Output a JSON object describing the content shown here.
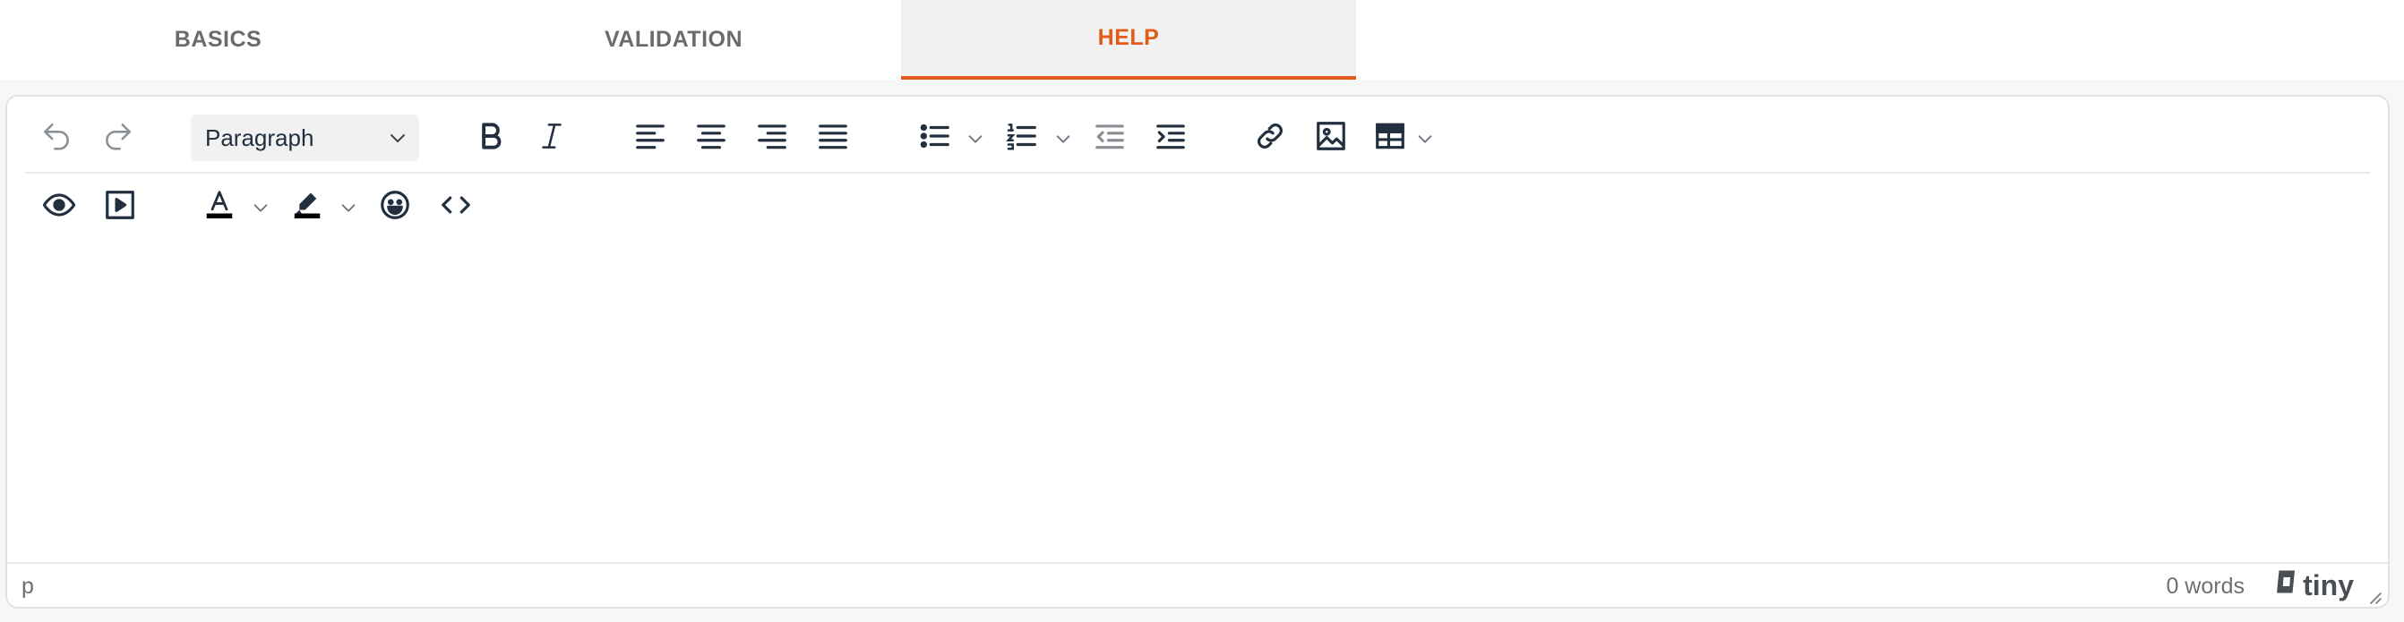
{
  "tabs": [
    {
      "label": "BASICS",
      "active": false
    },
    {
      "label": "VALIDATION",
      "active": false
    },
    {
      "label": "HELP",
      "active": true
    }
  ],
  "colors": {
    "accent": "#e35b1a",
    "icon": "#222f3e",
    "tab_text": "#6b6b6b",
    "border": "#e1e1e1"
  },
  "toolbar": {
    "row1": [
      {
        "name": "undo-icon",
        "dim": true
      },
      {
        "name": "redo-icon",
        "dim": true
      },
      {
        "name": "block-format-select",
        "value": "Paragraph"
      },
      {
        "name": "bold-icon"
      },
      {
        "name": "italic-icon"
      },
      {
        "name": "align-left-icon"
      },
      {
        "name": "align-center-icon"
      },
      {
        "name": "align-right-icon"
      },
      {
        "name": "align-justify-icon"
      },
      {
        "name": "bullet-list-icon",
        "has_dropdown": true
      },
      {
        "name": "numbered-list-icon",
        "has_dropdown": true
      },
      {
        "name": "outdent-icon",
        "dim": true
      },
      {
        "name": "indent-icon"
      },
      {
        "name": "link-icon"
      },
      {
        "name": "image-icon"
      },
      {
        "name": "table-icon",
        "has_dropdown": true
      }
    ],
    "row2": [
      {
        "name": "preview-icon"
      },
      {
        "name": "media-icon"
      },
      {
        "name": "text-color-icon",
        "has_dropdown": true
      },
      {
        "name": "highlight-color-icon",
        "has_dropdown": true
      },
      {
        "name": "emoji-icon"
      },
      {
        "name": "source-code-icon"
      }
    ],
    "block_format": "Paragraph"
  },
  "statusbar": {
    "path": "p",
    "word_count": "0 words",
    "brand": "tiny"
  }
}
